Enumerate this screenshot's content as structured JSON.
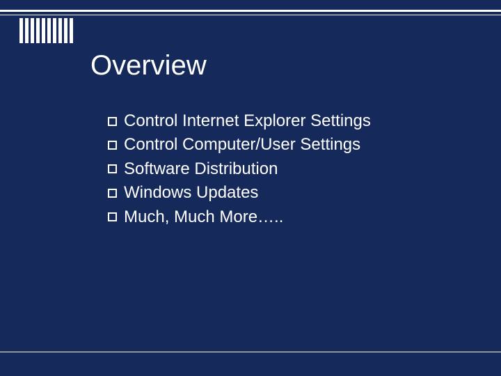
{
  "slide": {
    "title": "Overview",
    "bullets": [
      "Control Internet Explorer Settings",
      "Control Computer/User Settings",
      "Software Distribution",
      "Windows Updates",
      "Much, Much More….."
    ]
  }
}
